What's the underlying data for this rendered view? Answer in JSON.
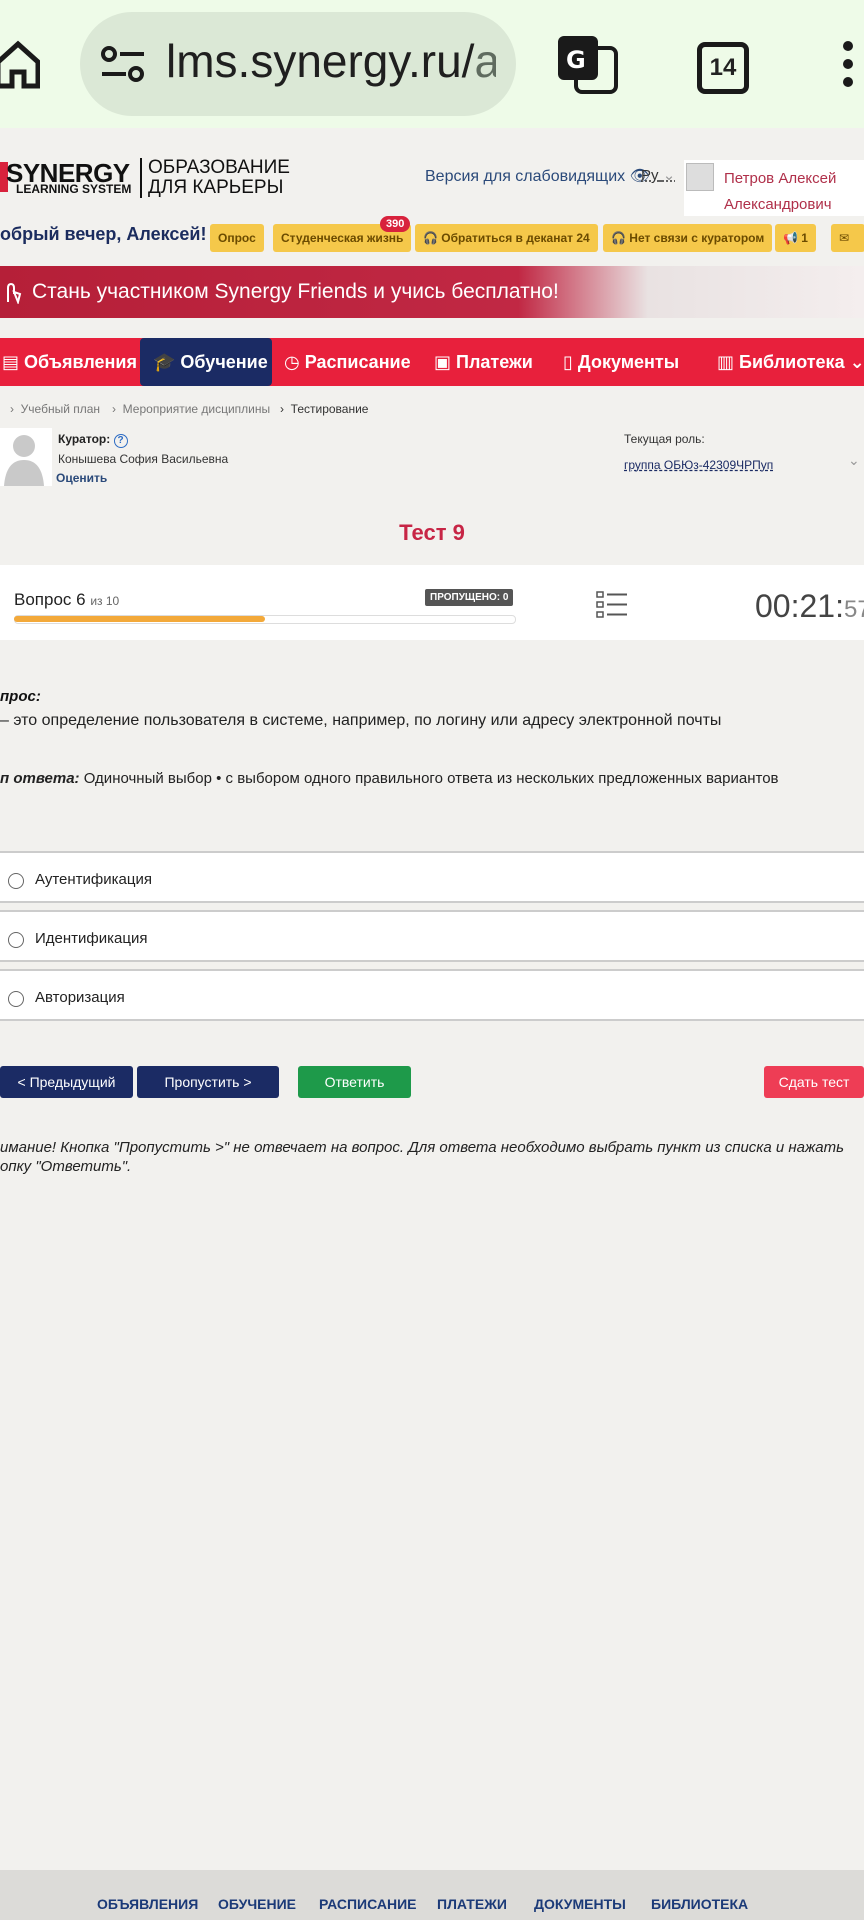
{
  "browser": {
    "url_main": "lms.synergy.ru/",
    "url_dim": "as",
    "tab_count": "14"
  },
  "header": {
    "logo_name": "SYNERGY",
    "logo_sub": "LEARNING SYSTEM",
    "logo_tagline_1": "ОБРАЗОВАНИЕ",
    "logo_tagline_2": "ДЛЯ КАРЬЕРЫ",
    "accessibility": "Версия для слабовидящих",
    "language": "Ру",
    "user_line1": "Петров Алексей",
    "user_line2": "Александрович"
  },
  "greeting": "обрый вечер, Алексей!",
  "chips": {
    "survey": "Опрос",
    "student_life": "Студенческая жизнь",
    "student_life_badge": "390",
    "dean": "Обратиться в деканат 24",
    "curator": "Нет связи с куратором",
    "alerts": "1"
  },
  "banner": {
    "text": "Стань участником Synergy Friends и учись бесплатно!"
  },
  "nav": {
    "announcements": "Объявления",
    "learning": "Обучение",
    "schedule": "Расписание",
    "payments": "Платежи",
    "documents": "Документы",
    "library": "Библиотека"
  },
  "breadcrumbs": {
    "plan": "Учебный план",
    "event": "Мероприятие дисциплины",
    "testing": "Тестирование"
  },
  "curator": {
    "label": "Куратор:",
    "name": "Конышева София Васильевна",
    "rate": "Оценить",
    "role_label": "Текущая роль:",
    "role_value": "группа ОБЮз-42309ЧРПуп"
  },
  "test": {
    "title": "Тест 9",
    "question_label": "Вопрос 6",
    "question_of": "из 10",
    "progress": 0.5,
    "skipped": "ПРОПУЩЕНО: 0",
    "timer_main": "00:21:",
    "timer_sec": "57"
  },
  "question": {
    "head": "прос:",
    "text": "– это определение пользователя в системе, например, по логину или адресу электронной почты",
    "type_label": "п ответа:",
    "type_text": "Одиночный выбор • с выбором одного правильного ответа из нескольких предложенных вариантов",
    "options": [
      "Аутентификация",
      "Идентификация",
      "Авторизация"
    ]
  },
  "buttons": {
    "prev": "< Предыдущий",
    "skip": "Пропустить >",
    "answer": "Ответить",
    "submit": "Сдать тест"
  },
  "note": {
    "line1": "имание! Кнопка \"Пропустить >\" не отвечает на вопрос. Для ответа необходимо выбрать пункт из списка и нажать",
    "line2": "опку \"Ответить\"."
  },
  "footer": {
    "announcements": "ОБЪЯВЛЕНИЯ",
    "learning": "ОБУЧЕНИЕ",
    "schedule": "РАСПИСАНИЕ",
    "payments": "ПЛАТЕЖИ",
    "documents": "ДОКУМЕНТЫ",
    "library": "БИБЛИОТЕКА"
  },
  "colors": {
    "nav_red": "#e8203c",
    "nav_active": "#1b2b64",
    "chip_yellow": "#f5c84a",
    "answer_green": "#1e9a4a",
    "submit_red": "#ee3d55",
    "progress_orange": "#f3a93a"
  }
}
